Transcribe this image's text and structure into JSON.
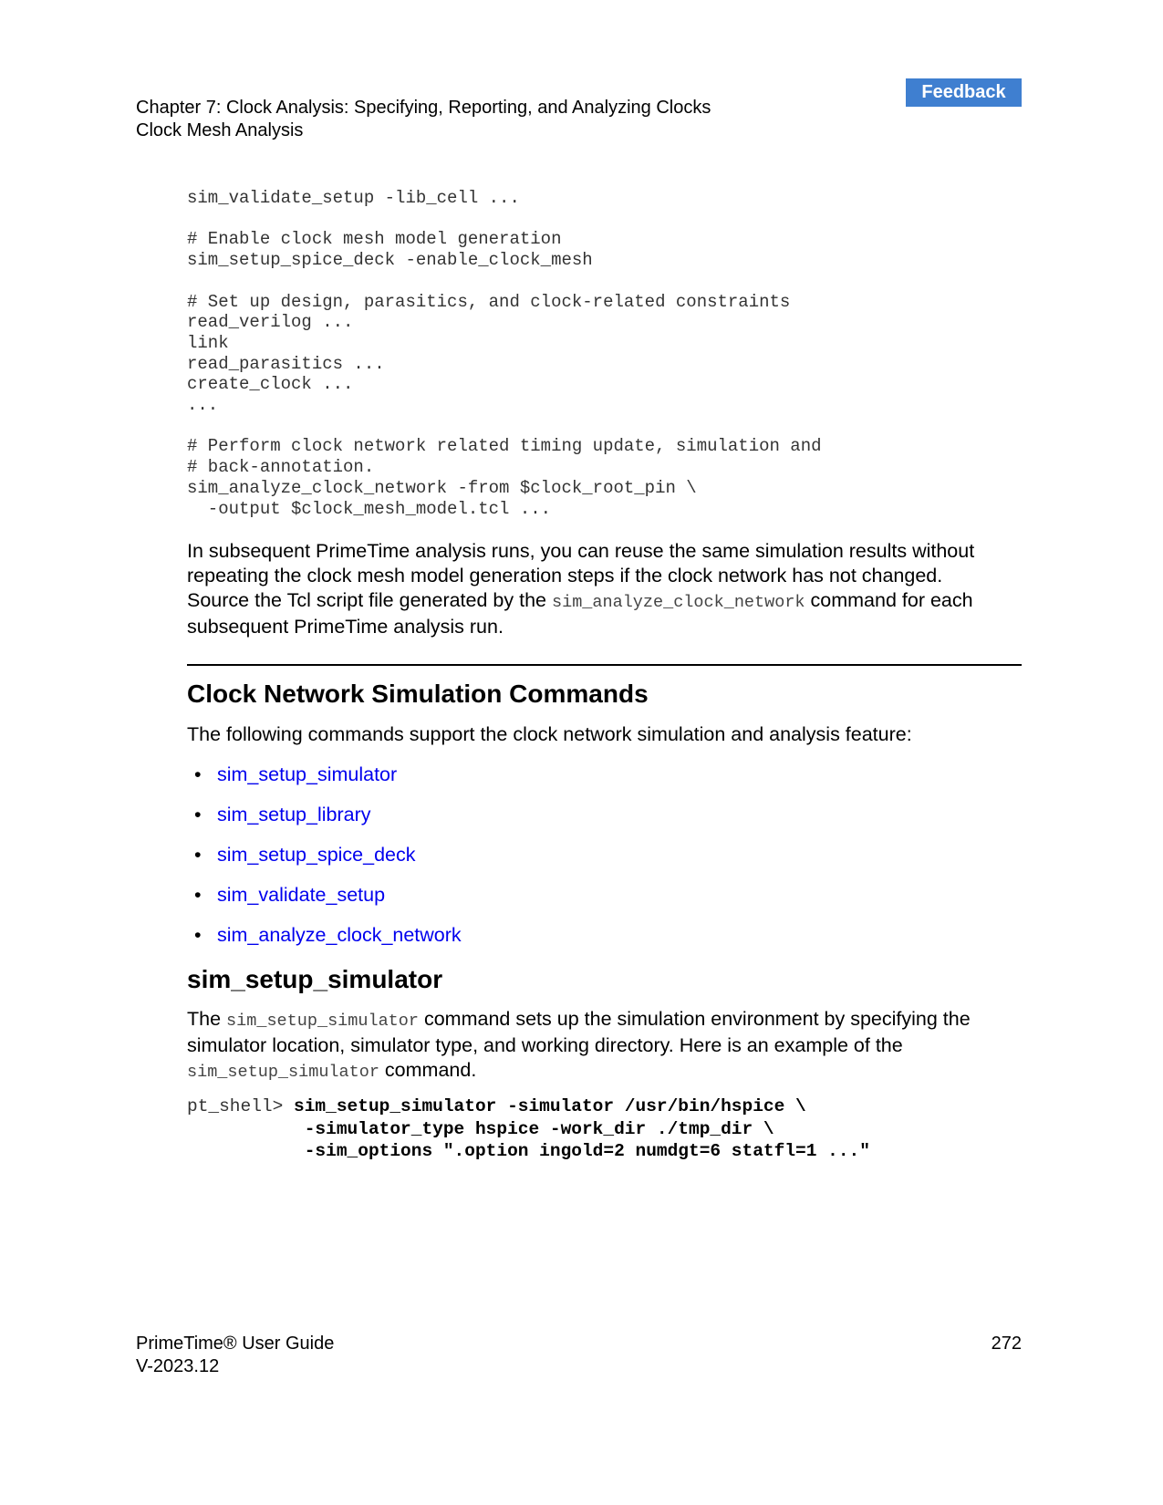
{
  "feedback_label": "Feedback",
  "header": {
    "chapter": "Chapter 7: Clock Analysis: Specifying, Reporting, and Analyzing Clocks",
    "section": "Clock Mesh Analysis"
  },
  "code_block_1": {
    "lines": [
      "sim_validate_setup -lib_cell ...",
      "",
      "# Enable clock mesh model generation",
      "sim_setup_spice_deck -enable_clock_mesh",
      "",
      "# Set up design, parasitics, and clock-related constraints",
      "read_verilog ...",
      "link",
      "read_parasitics ...",
      "create_clock ...",
      "...",
      "",
      "# Perform clock network related timing update, simulation and",
      "# back-annotation.",
      "sim_analyze_clock_network -from $clock_root_pin \\",
      "  -output $clock_mesh_model.tcl ..."
    ]
  },
  "para1": {
    "text_1": "In subsequent PrimeTime analysis runs, you can reuse the same simulation results without repeating the clock mesh model generation steps if the clock network has not changed. Source the Tcl script file generated by the",
    "code": "sim_analyze_clock_network",
    "text_2": "command for each subsequent PrimeTime analysis run."
  },
  "section": {
    "title": "Clock Network Simulation Commands",
    "intro": "The following commands support the clock network simulation and analysis feature:",
    "bullet": "•",
    "commands": [
      "sim_setup_simulator",
      "sim_setup_library",
      "sim_setup_spice_deck",
      "sim_validate_setup",
      "sim_analyze_clock_network"
    ]
  },
  "subsection": {
    "title": "sim_setup_simulator",
    "text_1": "The",
    "code_1": "sim_setup_simulator",
    "text_2": "command sets up the simulation environment by specifying the simulator location, simulator type, and working directory. Here is an example of the",
    "code_2": "sim_setup_simulator",
    "text_3": "command."
  },
  "example": {
    "prompt": "pt_shell> ",
    "line_1": "sim_setup_simulator -simulator /usr/bin/hspice \\",
    "line_2": "-simulator_type hspice -work_dir ./tmp_dir \\",
    "line_3": "-sim_options \".option ingold=2 numdgt=6 statfl=1 ...\"",
    "indent": "           "
  },
  "footer": {
    "product": "PrimeTime® User Guide",
    "version": "V-2023.12",
    "page": "272"
  }
}
